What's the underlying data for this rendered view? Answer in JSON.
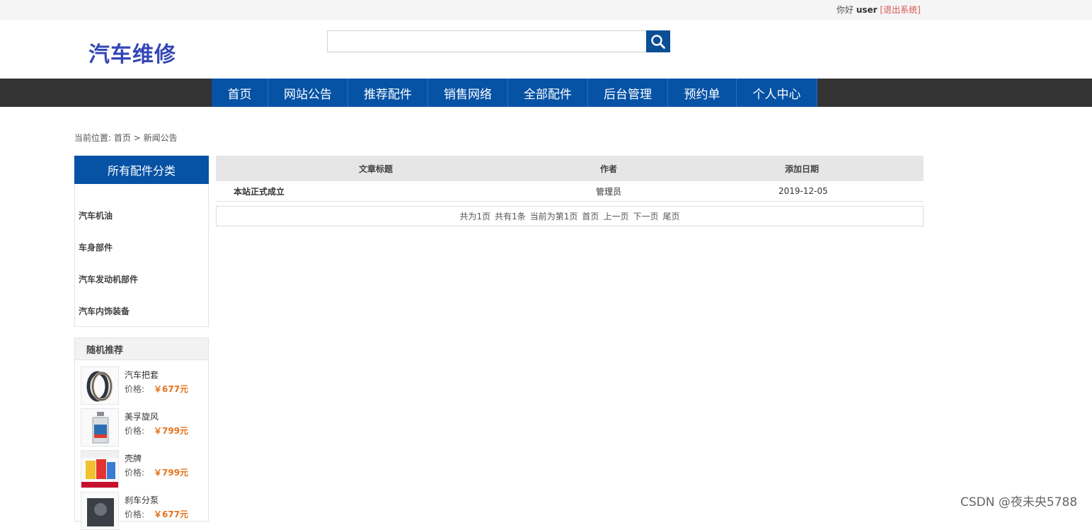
{
  "topbar": {
    "greeting": "你好",
    "username": "user",
    "logout_label": "[退出系统]"
  },
  "header": {
    "logo_text": "汽车维修",
    "search": {
      "value": "",
      "placeholder": ""
    }
  },
  "nav": {
    "items": [
      "首页",
      "网站公告",
      "推荐配件",
      "销售网络",
      "全部配件",
      "后台管理",
      "预约单",
      "个人中心"
    ]
  },
  "breadcrumb": {
    "label": "当前位置:",
    "home": "首页",
    "separator": ">",
    "current": "新闻公告"
  },
  "sidebar": {
    "category_title": "所有配件分类",
    "categories": [
      "汽车机油",
      "车身部件",
      "汽车发动机部件",
      "汽车内饰装备"
    ],
    "recommend_title": "随机推荐",
    "recommend": [
      {
        "name": "汽车把套",
        "price_label": "价格:",
        "price": "￥677元",
        "thumb_icon": "steering-cover-icon"
      },
      {
        "name": "美孚旋风",
        "price_label": "价格:",
        "price": "￥799元",
        "thumb_icon": "oil-bottle-icon"
      },
      {
        "name": "壳牌",
        "price_label": "价格:",
        "price": "￥799元",
        "thumb_icon": "oil-set-icon"
      },
      {
        "name": "刹车分泵",
        "price_label": "价格:",
        "price": "￥677元",
        "thumb_icon": "brake-cylinder-icon"
      }
    ]
  },
  "table": {
    "headers": [
      "文章标题",
      "作者",
      "添加日期"
    ],
    "rows": [
      {
        "title": "本站正式成立",
        "author": "管理员",
        "date": "2019-12-05"
      }
    ]
  },
  "pager": {
    "total_pages": "共为1页",
    "total_items": "共有1条",
    "current": "当前为第1页",
    "first": "首页",
    "prev": "上一页",
    "next": "下一页",
    "last": "尾页"
  },
  "watermark": "CSDN @夜未央5788",
  "colors": {
    "brand_blue": "#0652a5",
    "logo_blue": "#3446b5",
    "nav_bg": "#333333",
    "price_orange": "#e4731b",
    "logout_red": "#d9534f"
  }
}
